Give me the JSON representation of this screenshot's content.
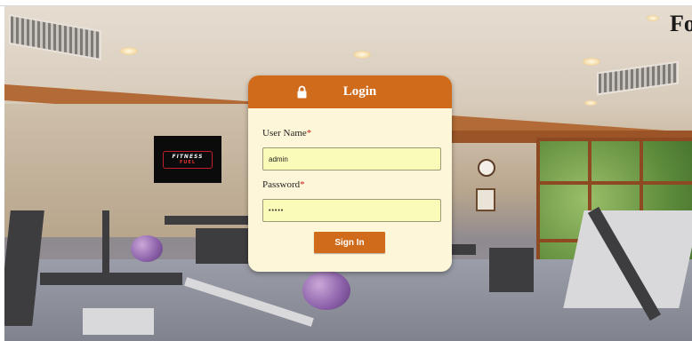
{
  "corner_heading": "Fo",
  "brand_logo": {
    "line1": "FITNESS",
    "line2": "FUEL"
  },
  "login": {
    "title": "Login",
    "icon": "lock-icon",
    "username_label": "User Name",
    "password_label": "Password",
    "required_mark": "*",
    "username_value": "admin",
    "password_value": "•••••",
    "submit_label": "Sign In"
  },
  "colors": {
    "accent": "#d06b1c",
    "card_bg": "#fef6d9",
    "input_bg": "#fbfbb9",
    "required": "#c4261d"
  }
}
